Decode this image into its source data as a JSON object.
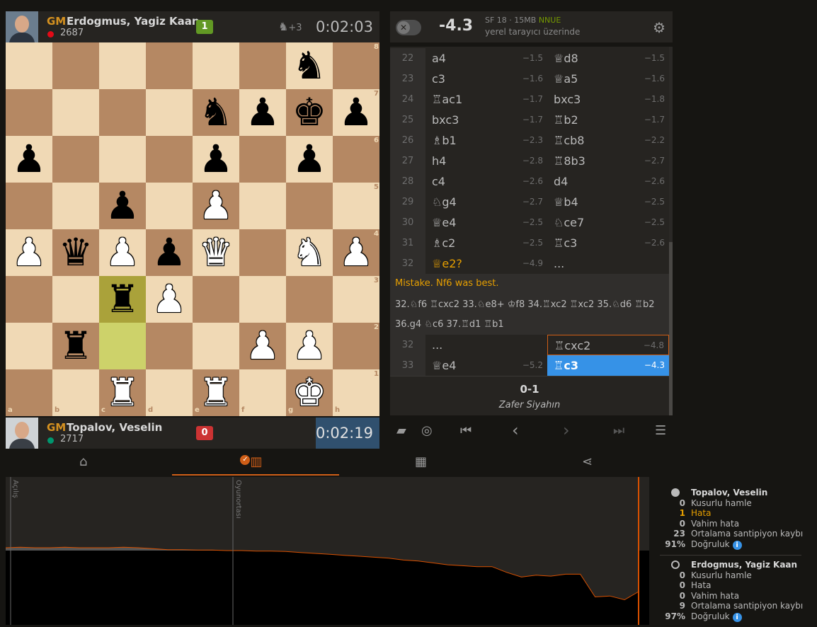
{
  "top_player": {
    "title": "GM",
    "name": "Erdogmus, Yagiz Kaan",
    "rating": "2687",
    "score": "1",
    "material": "+3",
    "material_icon": "knight-icon",
    "clock": "0:02:03",
    "flag_color": "#e30a17"
  },
  "bottom_player": {
    "title": "GM",
    "name": "Topalov, Veselin",
    "rating": "2717",
    "score": "0",
    "clock": "0:02:19",
    "flag_color": "#00966e"
  },
  "board": {
    "files": [
      "a",
      "b",
      "c",
      "d",
      "e",
      "f",
      "g",
      "h"
    ],
    "ranks": [
      "8",
      "7",
      "6",
      "5",
      "4",
      "3",
      "2",
      "1"
    ],
    "highlight": [
      "c3",
      "c2"
    ],
    "pieces": [
      {
        "sq": "g8",
        "p": "♞",
        "c": "b"
      },
      {
        "sq": "e7",
        "p": "♞",
        "c": "b"
      },
      {
        "sq": "f7",
        "p": "♟",
        "c": "b"
      },
      {
        "sq": "g7",
        "p": "♚",
        "c": "b"
      },
      {
        "sq": "h7",
        "p": "♟",
        "c": "b"
      },
      {
        "sq": "a6",
        "p": "♟",
        "c": "b"
      },
      {
        "sq": "e6",
        "p": "♟",
        "c": "b"
      },
      {
        "sq": "g6",
        "p": "♟",
        "c": "b"
      },
      {
        "sq": "c5",
        "p": "♟",
        "c": "b"
      },
      {
        "sq": "e5",
        "p": "♟",
        "c": "w"
      },
      {
        "sq": "a4",
        "p": "♟",
        "c": "w"
      },
      {
        "sq": "b4",
        "p": "♛",
        "c": "b"
      },
      {
        "sq": "c4",
        "p": "♟",
        "c": "w"
      },
      {
        "sq": "d4",
        "p": "♟",
        "c": "b"
      },
      {
        "sq": "e4",
        "p": "♛",
        "c": "w"
      },
      {
        "sq": "g4",
        "p": "♞",
        "c": "w"
      },
      {
        "sq": "h4",
        "p": "♟",
        "c": "w"
      },
      {
        "sq": "c3",
        "p": "♜",
        "c": "b"
      },
      {
        "sq": "d3",
        "p": "♟",
        "c": "w"
      },
      {
        "sq": "b2",
        "p": "♜",
        "c": "b"
      },
      {
        "sq": "f2",
        "p": "♟",
        "c": "w"
      },
      {
        "sq": "g2",
        "p": "♟",
        "c": "w"
      },
      {
        "sq": "c1",
        "p": "♜",
        "c": "w"
      },
      {
        "sq": "e1",
        "p": "♜",
        "c": "w"
      },
      {
        "sq": "g1",
        "p": "♚",
        "c": "w"
      }
    ]
  },
  "engine": {
    "eval": "-4.3",
    "info": "SF 18 · 15MB",
    "nnue": "NNUE",
    "sub": "yerel tarayıcı üzerinde"
  },
  "moves": [
    {
      "n": "22",
      "w": "a4",
      "ws": "−1.5",
      "b": "♕d8",
      "bs": "−1.5"
    },
    {
      "n": "23",
      "w": "c3",
      "ws": "−1.6",
      "b": "♕a5",
      "bs": "−1.6"
    },
    {
      "n": "24",
      "w": "♖ac1",
      "ws": "−1.7",
      "b": "bxc3",
      "bs": "−1.8"
    },
    {
      "n": "25",
      "w": "bxc3",
      "ws": "−1.7",
      "b": "♖b2",
      "bs": "−1.7"
    },
    {
      "n": "26",
      "w": "♗b1",
      "ws": "−2.3",
      "b": "♖cb8",
      "bs": "−2.2"
    },
    {
      "n": "27",
      "w": "h4",
      "ws": "−2.8",
      "b": "♖8b3",
      "bs": "−2.7"
    },
    {
      "n": "28",
      "w": "c4",
      "ws": "−2.6",
      "b": "d4",
      "bs": "−2.6"
    },
    {
      "n": "29",
      "w": "♘g4",
      "ws": "−2.7",
      "b": "♕b4",
      "bs": "−2.5"
    },
    {
      "n": "30",
      "w": "♕e4",
      "ws": "−2.5",
      "b": "♘ce7",
      "bs": "−2.5"
    },
    {
      "n": "31",
      "w": "♗c2",
      "ws": "−2.5",
      "b": "♖c3",
      "bs": "−2.6"
    },
    {
      "n": "32",
      "w": "♕e2?",
      "ws": "−4.9",
      "b": "...",
      "bs": ""
    }
  ],
  "comment": {
    "text": "Mistake. Nf6 was best.",
    "variation": "32.♘f6 ♖cxc2 33.♘e8+ ♔f8 34.♖xc2 ♖xc2 35.♘d6 ♖b2 36.g4 ♘c6 37.♖d1 ♖b1"
  },
  "moves_after": [
    {
      "n": "32",
      "w": "...",
      "ws": "",
      "b": "♖cxc2",
      "bs": "−4.8"
    },
    {
      "n": "33",
      "w": "♕e4",
      "ws": "−5.2",
      "b": "♖c3",
      "bs": "−4.3"
    }
  ],
  "result": {
    "score": "0-1",
    "text": "Zafer Siyahın"
  },
  "controls": [
    "book-icon",
    "target-icon",
    "first-icon",
    "prev-icon",
    "next-icon",
    "last-icon",
    "menu-icon"
  ],
  "tabs": [
    "tag-icon",
    "chart-icon",
    "grid-icon",
    "share-icon"
  ],
  "graph": {
    "phases": [
      "Açılış",
      "Oyunortası"
    ],
    "chart_data": {
      "type": "area",
      "series": [
        {
          "values": [
            0.3,
            0.35,
            0.3,
            0.3,
            0.35,
            0.3,
            0.3,
            0.3,
            0.35,
            0.3,
            0.2,
            0.1,
            0.1,
            0.05,
            0.05,
            0.0,
            0.0,
            -0.05,
            -0.05,
            -0.1,
            -0.2,
            -0.3,
            -0.4,
            -0.5,
            -0.6,
            -0.7,
            -0.8,
            -1.0,
            -1.1,
            -1.3,
            -1.5,
            -1.6,
            -1.7,
            -1.7,
            -2.3,
            -2.8,
            -2.6,
            -2.7,
            -2.5,
            -2.5,
            -4.9,
            -4.8,
            -5.2,
            -4.3
          ]
        }
      ],
      "ylim": [
        -7,
        7
      ]
    }
  },
  "summary": [
    {
      "name": "Topalov, Veselin",
      "dot": "#bababa",
      "rows": [
        {
          "v": "0",
          "l": "Kusurlu hamle"
        },
        {
          "v": "1",
          "l": "Hata",
          "err": true
        },
        {
          "v": "0",
          "l": "Vahim hata"
        },
        {
          "v": "23",
          "l": "Ortalama santipiyon kaybı"
        },
        {
          "v": "91%",
          "l": "Doğruluk"
        }
      ]
    },
    {
      "name": "Erdogmus, Yagiz Kaan",
      "dot": "none",
      "rows": [
        {
          "v": "0",
          "l": "Kusurlu hamle"
        },
        {
          "v": "0",
          "l": "Hata"
        },
        {
          "v": "0",
          "l": "Vahim hata"
        },
        {
          "v": "9",
          "l": "Ortalama santipiyon kaybı"
        },
        {
          "v": "97%",
          "l": "Doğruluk"
        }
      ]
    }
  ]
}
